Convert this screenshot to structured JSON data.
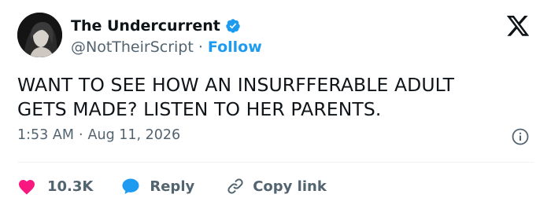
{
  "header": {
    "display_name": "The Undercurrent",
    "handle": "@NotTheirScript",
    "separator": "·",
    "follow_label": "Follow"
  },
  "tweet": {
    "text_line1": "WANT TO SEE HOW AN INSURFFERABLE ADULT",
    "text_line2": "GETS MADE? LISTEN TO HER PARENTS.",
    "time": "1:53 AM",
    "date": "Aug 11, 2026",
    "separator": "·"
  },
  "actions": {
    "likes": "10.3K",
    "reply_label": "Reply",
    "copy_label": "Copy link"
  },
  "colors": {
    "accent": "#1d9bf0",
    "like": "#f91880",
    "text": "#0f1419",
    "muted": "#536471"
  },
  "icons": [
    "avatar",
    "verified-badge-icon",
    "x-logo-icon",
    "info-icon",
    "heart-icon",
    "reply-bubble-icon",
    "link-icon"
  ]
}
